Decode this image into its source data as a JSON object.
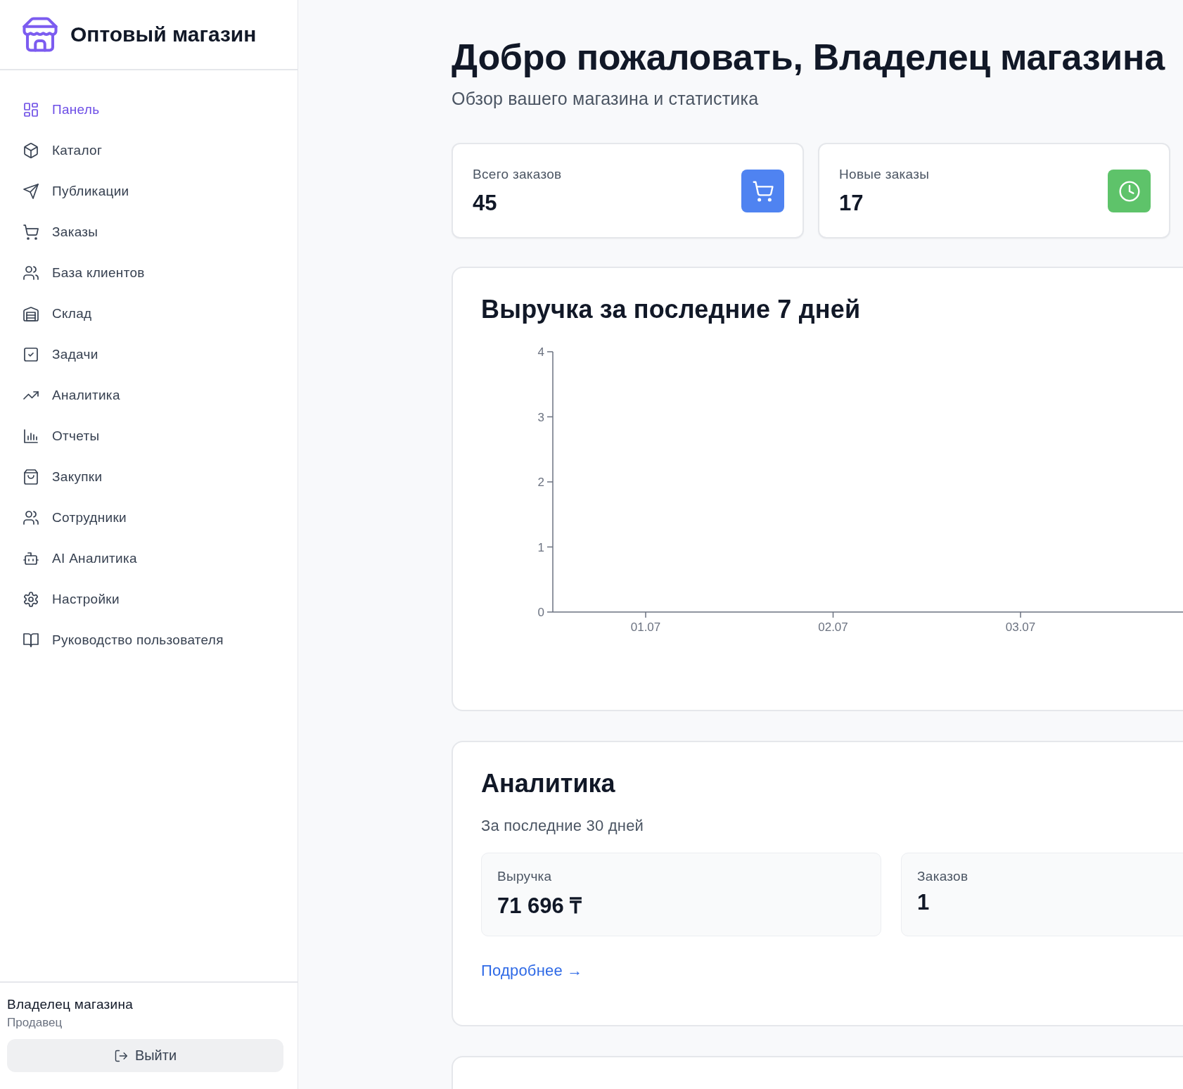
{
  "sidebar": {
    "brand": "Оптовый магазин",
    "items": [
      {
        "label": "Панель",
        "kind": "grid",
        "selected": true
      },
      {
        "label": "Каталог",
        "kind": "box",
        "selected": false
      },
      {
        "label": "Публикации",
        "kind": "send",
        "selected": false
      },
      {
        "label": "Заказы",
        "kind": "cart",
        "selected": false
      },
      {
        "label": "База клиентов",
        "kind": "users",
        "selected": false
      },
      {
        "label": "Склад",
        "kind": "warehouse",
        "selected": false
      },
      {
        "label": "Задачи",
        "kind": "check",
        "selected": false
      },
      {
        "label": "Аналитика",
        "kind": "trend",
        "selected": false
      },
      {
        "label": "Отчеты",
        "kind": "bars",
        "selected": false
      },
      {
        "label": "Закупки",
        "kind": "bag",
        "selected": false
      },
      {
        "label": "Сотрудники",
        "kind": "users",
        "selected": false
      },
      {
        "label": "AI Аналитика",
        "kind": "bot",
        "selected": false
      },
      {
        "label": "Настройки",
        "kind": "gear",
        "selected": false
      },
      {
        "label": "Руководство пользователя",
        "kind": "book",
        "selected": false
      }
    ],
    "user": {
      "name": "Владелец магазина",
      "role": "Продавец"
    },
    "logout_button": "Выйти"
  },
  "header": {
    "title": "Добро пожаловать, Владелец магазина",
    "subtitle": "Обзор вашего магазина и статистика"
  },
  "stats": [
    {
      "label": "Всего заказов",
      "value": "45",
      "kind": "cart",
      "color": "#4f83f1"
    },
    {
      "label": "Новые заказы",
      "value": "17",
      "kind": "clock",
      "color": "#5ec36a"
    }
  ],
  "revenue_chart": {
    "title": "Выручка за последние 7 дней",
    "chart_data": {
      "type": "line",
      "categories": [
        "01.07",
        "02.07",
        "03.07"
      ],
      "ylim": [
        0,
        4
      ],
      "yticks": [
        0,
        1,
        2,
        3,
        4
      ]
    }
  },
  "analytics": {
    "title": "Аналитика",
    "subtitle": "За последние 30 дней",
    "metrics": [
      {
        "label": "Выручка",
        "value": "71 696 ₸"
      },
      {
        "label": "Заказов",
        "value": "1"
      }
    ],
    "link": "Подробнее →"
  }
}
